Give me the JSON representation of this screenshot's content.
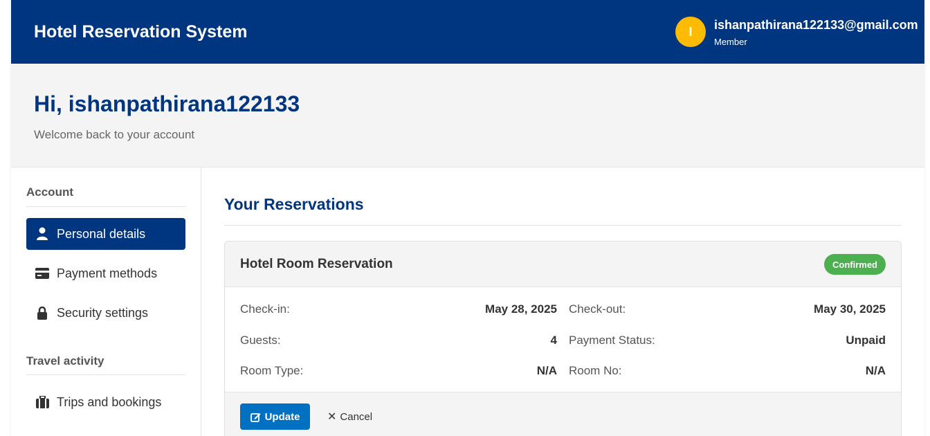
{
  "header": {
    "brand": "Hotel Reservation System",
    "avatar_initial": "I",
    "user_email": "ishanpathirana122133@gmail.com",
    "user_role": "Member"
  },
  "welcome": {
    "greeting": "Hi, ishanpathirana122133",
    "subtitle": "Welcome back to your account"
  },
  "sidebar": {
    "account_title": "Account",
    "travel_title": "Travel activity",
    "items": [
      {
        "label": "Personal details",
        "icon": "user-icon",
        "active": true
      },
      {
        "label": "Payment methods",
        "icon": "credit-card-icon",
        "active": false
      },
      {
        "label": "Security settings",
        "icon": "lock-icon",
        "active": false
      },
      {
        "label": "Trips and bookings",
        "icon": "suitcase-icon",
        "active": false
      }
    ]
  },
  "main": {
    "title": "Your Reservations",
    "reservation": {
      "title": "Hotel Room Reservation",
      "status": "Confirmed",
      "checkin_label": "Check-in:",
      "checkin_value": "May 28, 2025",
      "checkout_label": "Check-out:",
      "checkout_value": "May 30, 2025",
      "guests_label": "Guests:",
      "guests_value": "4",
      "payment_label": "Payment Status:",
      "payment_value": "Unpaid",
      "roomtype_label": "Room Type:",
      "roomtype_value": "N/A",
      "roomno_label": "Room No:",
      "roomno_value": "N/A",
      "update_label": "Update",
      "cancel_label": "Cancel"
    }
  },
  "colors": {
    "brand_blue": "#003580",
    "accent_yellow": "#febb02",
    "button_blue": "#0071c2",
    "status_green": "#4caf50"
  }
}
